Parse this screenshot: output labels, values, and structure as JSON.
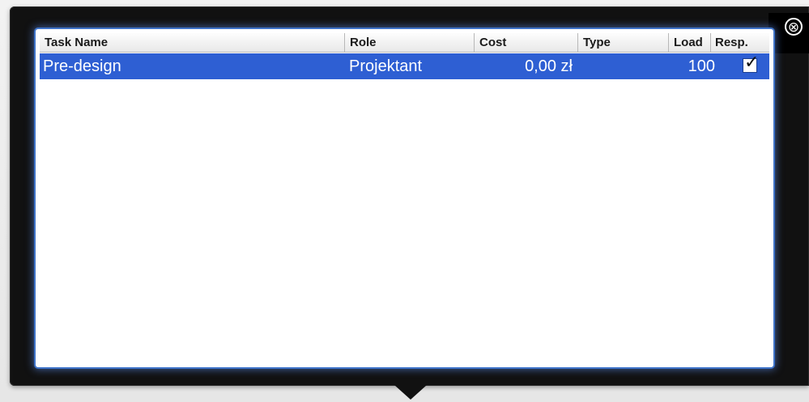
{
  "close_icon": "⊗",
  "table": {
    "columns": [
      {
        "key": "task_name",
        "label": "Task Name"
      },
      {
        "key": "role",
        "label": "Role"
      },
      {
        "key": "cost",
        "label": "Cost"
      },
      {
        "key": "type",
        "label": "Type"
      },
      {
        "key": "load",
        "label": "Load"
      },
      {
        "key": "resp",
        "label": "Resp."
      }
    ],
    "rows": [
      {
        "task_name": "Pre-design",
        "role": "Projektant",
        "cost": "0,00 zł",
        "type": "",
        "load": "100",
        "resp_checked": true,
        "selected": true
      }
    ]
  },
  "colors": {
    "selection": "#2e5fd3",
    "panel": "#111111",
    "frame_glow": "#3e73c9"
  }
}
